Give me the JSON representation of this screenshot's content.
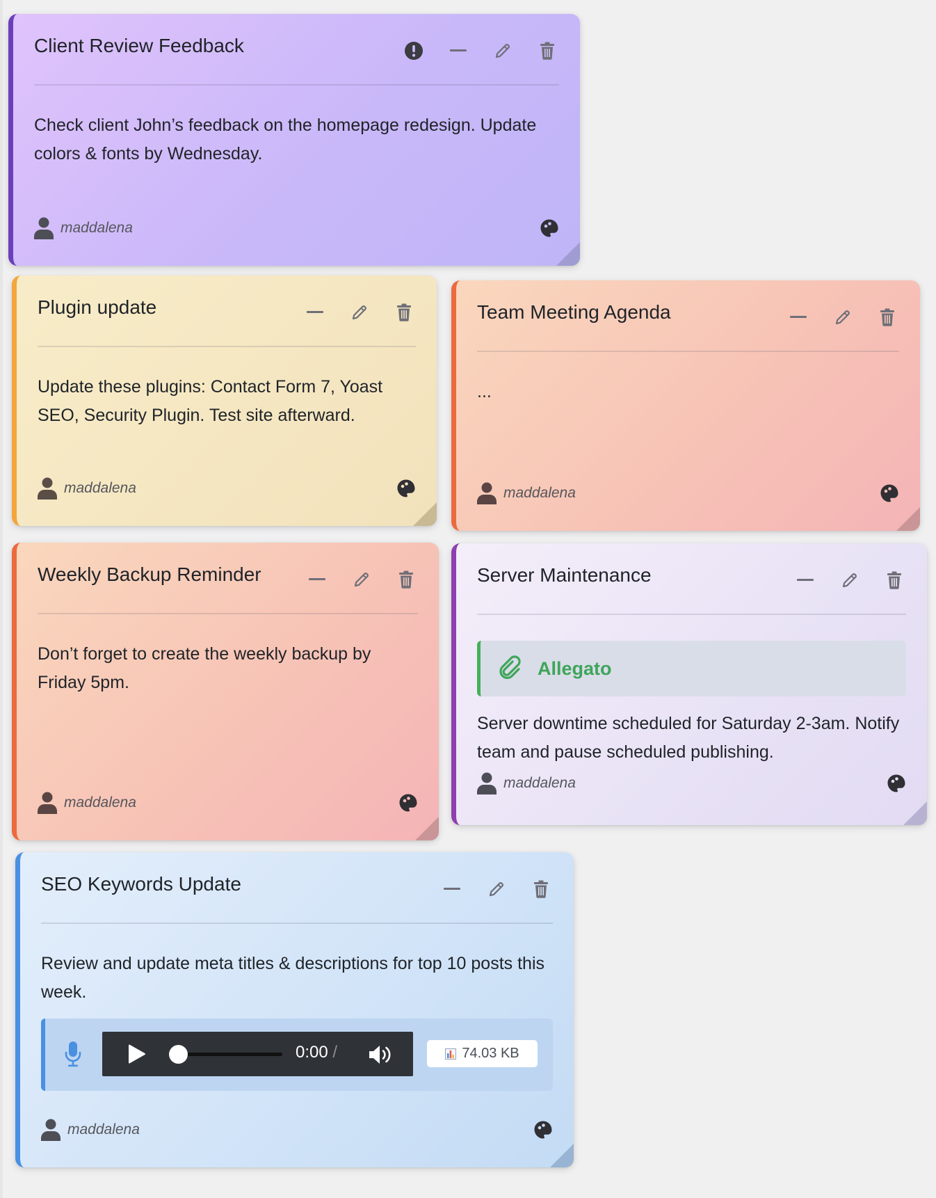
{
  "author_name": "maddalena",
  "action_titles": {
    "priority": "Important",
    "minimize": "Minimize",
    "edit": "Edit",
    "delete": "Delete",
    "color": "Change color"
  },
  "notes": [
    {
      "title": "Client Review Feedback",
      "body": "Check client John’s feedback on the homepage redesign. Update colors & fonts by Wednesday.",
      "author": "maddalena",
      "color": "#d3bdfb",
      "accent": "#6b3fbb",
      "priority": true
    },
    {
      "title": "Plugin update",
      "body": "Update these plugins: Contact Form 7, Yoast SEO, Security Plugin. Test site afterward.",
      "author": "maddalena",
      "color": "#f5e6c2",
      "accent": "#f3a63a"
    },
    {
      "title": "Team Meeting Agenda",
      "body": "...",
      "author": "maddalena",
      "color": "#f7c6b6",
      "accent": "#ec6a3c"
    },
    {
      "title": "Weekly Backup Reminder",
      "body": "Don’t forget to create the weekly backup by Friday 5pm.",
      "author": "maddalena",
      "color": "#f7c6b6",
      "accent": "#ec6a3c"
    },
    {
      "title": "Server Maintenance",
      "attachment_label": "Allegato",
      "body": "Server downtime scheduled for Saturday 2-3am. Notify team and pause scheduled publishing.",
      "author": "maddalena",
      "color": "#ebe5f7",
      "accent": "#8e3fb0"
    },
    {
      "title": "SEO Keywords Update",
      "body": "Review and update meta titles & descriptions for top 10 posts this week.",
      "author": "maddalena",
      "color": "#d2e4f8",
      "accent": "#4a90e2",
      "audio": {
        "current_time": "0:00",
        "separator": "/",
        "progress": 0,
        "file_size": "74.03 KB"
      }
    }
  ]
}
